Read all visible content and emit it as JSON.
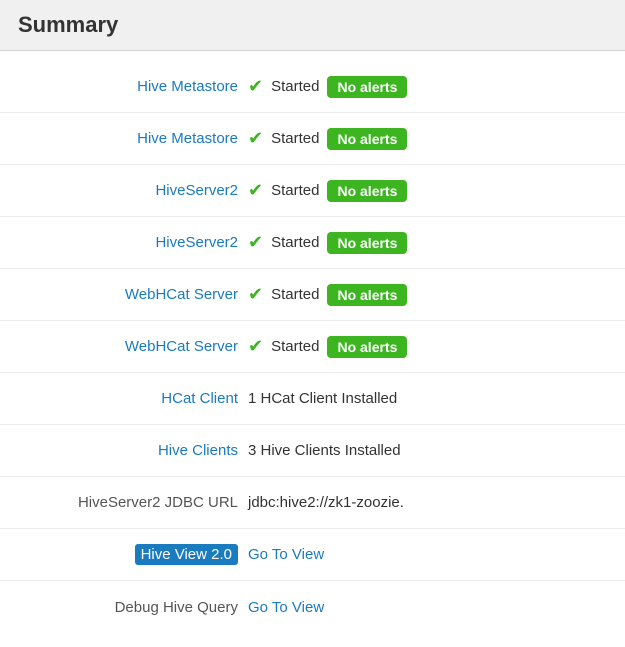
{
  "header": {
    "title": "Summary"
  },
  "rows": [
    {
      "id": "hive-metastore-1",
      "label": "Hive Metastore",
      "label_type": "link",
      "status": "started",
      "status_text": "Started",
      "badge": "No alerts",
      "badge_type": "no-alerts"
    },
    {
      "id": "hive-metastore-2",
      "label": "Hive Metastore",
      "label_type": "link",
      "status": "started",
      "status_text": "Started",
      "badge": "No alerts",
      "badge_type": "no-alerts"
    },
    {
      "id": "hiveserver2-1",
      "label": "HiveServer2",
      "label_type": "link",
      "status": "started",
      "status_text": "Started",
      "badge": "No alerts",
      "badge_type": "no-alerts"
    },
    {
      "id": "hiveserver2-2",
      "label": "HiveServer2",
      "label_type": "link",
      "status": "started",
      "status_text": "Started",
      "badge": "No alerts",
      "badge_type": "no-alerts"
    },
    {
      "id": "webhcat-server-1",
      "label": "WebHCat Server",
      "label_type": "link",
      "status": "started",
      "status_text": "Started",
      "badge": "No alerts",
      "badge_type": "no-alerts"
    },
    {
      "id": "webhcat-server-2",
      "label": "WebHCat Server",
      "label_type": "link",
      "status": "started",
      "status_text": "Started",
      "badge": "No alerts",
      "badge_type": "no-alerts"
    },
    {
      "id": "hcat-client",
      "label": "HCat Client",
      "label_type": "link",
      "value_text": "1 HCat Client Installed",
      "badge_type": "text"
    },
    {
      "id": "hive-clients",
      "label": "Hive Clients",
      "label_type": "link",
      "value_text": "3 Hive Clients Installed",
      "badge_type": "text"
    },
    {
      "id": "hiveserver2-jdbc-url",
      "label": "HiveServer2 JDBC URL",
      "label_type": "plain",
      "value_text": "jdbc:hive2://zk1-zoozie.",
      "badge_type": "url"
    },
    {
      "id": "hive-view-2",
      "label": "Hive View 2.0",
      "label_type": "highlight",
      "value_text": "Go To View",
      "badge_type": "link"
    },
    {
      "id": "debug-hive-query",
      "label": "Debug Hive Query",
      "label_type": "plain",
      "value_text": "Go To View",
      "badge_type": "link"
    }
  ],
  "icons": {
    "check": "✔"
  },
  "colors": {
    "link": "#1a7bbf",
    "green_badge": "#3cb521",
    "highlight_bg": "#1a7bbf"
  }
}
